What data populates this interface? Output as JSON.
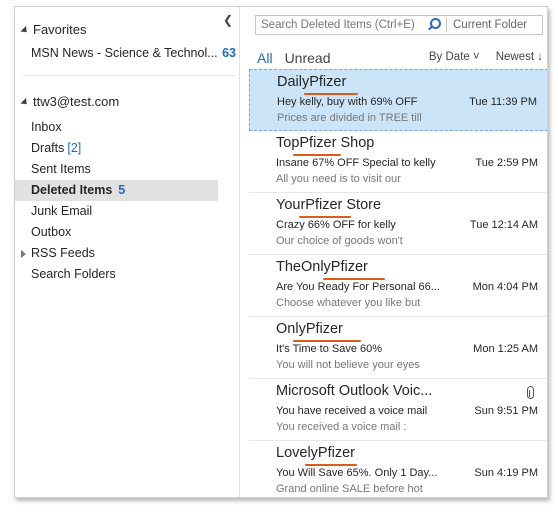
{
  "nav": {
    "favorites_label": "Favorites",
    "favorite_item": {
      "label": "MSN News - Science & Technol...",
      "count": "63"
    },
    "account_label": "ttw3@test.com",
    "folders": [
      {
        "label": "Inbox"
      },
      {
        "label": "Drafts",
        "count": "[2]"
      },
      {
        "label": "Sent Items"
      },
      {
        "label": "Deleted Items",
        "count": "5"
      },
      {
        "label": "Junk Email"
      },
      {
        "label": "Outbox"
      },
      {
        "label": "RSS Feeds"
      },
      {
        "label": "Search Folders"
      }
    ]
  },
  "search": {
    "placeholder": "Search Deleted Items (Ctrl+E)",
    "scope": "Current Folder"
  },
  "filters": {
    "all": "All",
    "unread": "Unread",
    "sort_by": "By Date ˅",
    "order": "Newest ↓"
  },
  "messages": [
    {
      "sender": "DailyPfizer",
      "subject": "Hey kelly, buy with 69% OFF",
      "time": "Tue 11:39 PM",
      "preview": "Prices are divided in TREE till"
    },
    {
      "sender": "TopPfizer Shop",
      "subject": "Insane 67% OFF Special to kelly",
      "time": "Tue 2:59 PM",
      "preview": "All you need is to visit our"
    },
    {
      "sender": "YourPfizer Store",
      "subject": "Crazy 66% OFF for kelly",
      "time": "Tue 12:14 AM",
      "preview": "Our choice of goods won't"
    },
    {
      "sender": "TheOnlyPfizer",
      "subject": "Are You Ready For Personal 66...",
      "time": "Mon 4:04 PM",
      "preview": "Choose whatever you like but"
    },
    {
      "sender": "OnlyPfizer",
      "subject": "It's Time to Save 60%",
      "time": "Mon 1:25 AM",
      "preview": "You will not believe your eyes"
    },
    {
      "sender": "Microsoft Outlook Voic...",
      "subject": "You have received a voice mail",
      "time": "Sun 9:51 PM",
      "preview": "You received a voice mail :"
    },
    {
      "sender": "LovelyPfizer",
      "subject": "You Will Save 65%. Only 1 Day...",
      "time": "Sun 4:19 PM",
      "preview": "Grand online SALE before hot"
    }
  ]
}
